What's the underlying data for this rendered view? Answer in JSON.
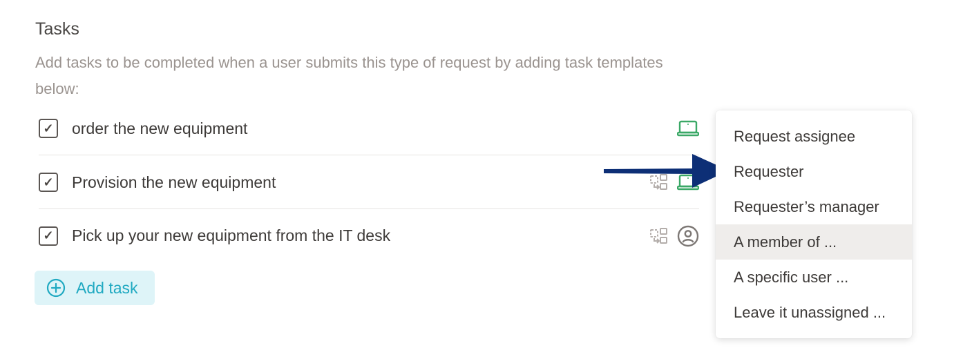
{
  "section": {
    "title": "Tasks",
    "description": "Add tasks to be completed when a user submits this type of request by adding task templates below:"
  },
  "tasks": [
    {
      "label": "order the new equipment",
      "checked": true,
      "icons": [
        "laptop-icon"
      ]
    },
    {
      "label": "Provision the new equipment",
      "checked": true,
      "icons": [
        "dependency-icon",
        "laptop-icon"
      ]
    },
    {
      "label": "Pick up your new equipment from the IT desk",
      "checked": true,
      "icons": [
        "dependency-icon",
        "user-circle-icon"
      ]
    }
  ],
  "checkbox_glyph": "✓",
  "add_task": {
    "label": "Add task",
    "icon": "plus-circle-icon"
  },
  "assignee_menu": {
    "items": [
      {
        "label": "Request assignee"
      },
      {
        "label": "Requester"
      },
      {
        "label": "Requester’s manager"
      },
      {
        "label": "A member of ...",
        "highlighted": true
      },
      {
        "label": "A specific user ..."
      },
      {
        "label": "Leave it unassigned ..."
      }
    ]
  },
  "colors": {
    "accent_green": "#3aa866",
    "accent_teal": "#1fa9c1",
    "add_task_bg": "#def4f8",
    "arrow": "#0d2f76",
    "icon_gray": "#b3adaa"
  }
}
